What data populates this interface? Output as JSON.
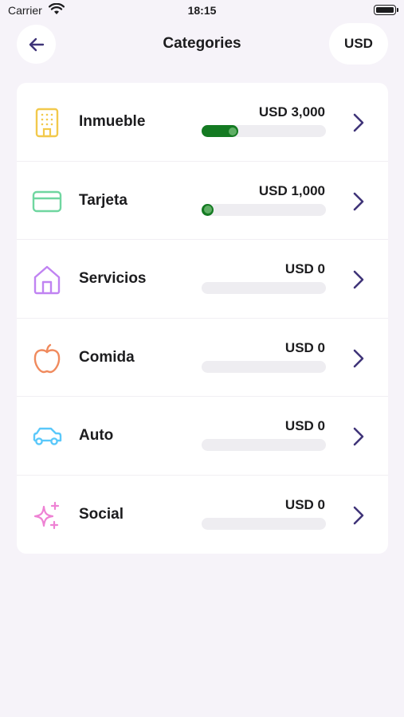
{
  "status_bar": {
    "carrier": "Carrier",
    "time": "18:15"
  },
  "nav": {
    "title": "Categories",
    "currency_button": "USD",
    "back_icon": "arrow-left-icon"
  },
  "colors": {
    "accent": "#3f3478",
    "progress": "#147a22",
    "background": "#f6f3f9"
  },
  "categories": [
    {
      "name": "Inmueble",
      "amount": "USD 3,000",
      "progress": 0.3,
      "icon": "building-icon",
      "icon_color": "#f2c94c"
    },
    {
      "name": "Tarjeta",
      "amount": "USD 1,000",
      "progress": 0.05,
      "icon": "credit-card-icon",
      "icon_color": "#6fd6a0"
    },
    {
      "name": "Servicios",
      "amount": "USD 0",
      "progress": 0,
      "icon": "house-icon",
      "icon_color": "#c083f2"
    },
    {
      "name": "Comida",
      "amount": "USD 0",
      "progress": 0,
      "icon": "apple-icon",
      "icon_color": "#f08a5d"
    },
    {
      "name": "Auto",
      "amount": "USD 0",
      "progress": 0,
      "icon": "car-icon",
      "icon_color": "#5ac8fa"
    },
    {
      "name": "Social",
      "amount": "USD 0",
      "progress": 0,
      "icon": "sparkles-icon",
      "icon_color": "#ee82d4"
    }
  ]
}
